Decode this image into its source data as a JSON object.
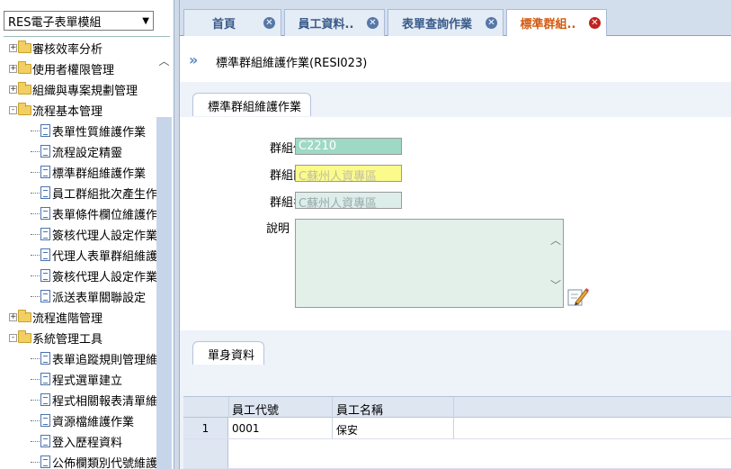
{
  "sidebar": {
    "module_select": "RES電子表單模組",
    "tree": [
      {
        "label": "審核效率分析",
        "type": "folder",
        "expander": "+"
      },
      {
        "label": "使用者權限管理",
        "type": "folder",
        "expander": "+"
      },
      {
        "label": "組織與專案規劃管理",
        "type": "folder",
        "expander": "+"
      },
      {
        "label": "流程基本管理",
        "type": "folder",
        "expander": "-"
      },
      {
        "label": "表單性質維護作業",
        "type": "doc"
      },
      {
        "label": "流程設定精靈",
        "type": "doc"
      },
      {
        "label": "標準群組維護作業",
        "type": "doc"
      },
      {
        "label": "員工群組批次產生作",
        "type": "doc"
      },
      {
        "label": "表單條件欄位維護作",
        "type": "doc"
      },
      {
        "label": "簽核代理人設定作業",
        "type": "doc"
      },
      {
        "label": "代理人表單群組維護",
        "type": "doc"
      },
      {
        "label": "簽核代理人設定作業",
        "type": "doc"
      },
      {
        "label": "派送表單關聯設定",
        "type": "doc"
      },
      {
        "label": "流程進階管理",
        "type": "folder",
        "expander": "+"
      },
      {
        "label": "系統管理工具",
        "type": "folder",
        "expander": "-"
      },
      {
        "label": "表單追蹤規則管理維",
        "type": "doc"
      },
      {
        "label": "程式選單建立",
        "type": "doc"
      },
      {
        "label": "程式相關報表清單維",
        "type": "doc"
      },
      {
        "label": "資源檔維護作業",
        "type": "doc"
      },
      {
        "label": "登入歷程資料",
        "type": "doc"
      },
      {
        "label": "公佈欄類別代號維護",
        "type": "doc"
      }
    ]
  },
  "tabs": [
    {
      "label": "首頁",
      "active": false
    },
    {
      "label": "員工資料..",
      "active": false
    },
    {
      "label": "表單查詢作業",
      "active": false
    },
    {
      "label": "標準群組..",
      "active": true
    }
  ],
  "page": {
    "title": "標準群組維護作業(RESI023)",
    "section1_label": "標準群組維護作業",
    "section2_label": "單身資料"
  },
  "form": {
    "code_label": "群組代號",
    "code_value": "C2210",
    "short_label": "群組簡稱",
    "short_value": "C蘇州人資專區",
    "name_label": "群組名稱",
    "name_value": "C蘇州人資專區",
    "desc_label": "說明",
    "desc_value": ""
  },
  "grid": {
    "columns": [
      "員工代號",
      "員工名稱"
    ],
    "rows": [
      {
        "num": "1",
        "emp_id": "0001",
        "emp_name": "保安"
      }
    ]
  },
  "colors": {
    "active_tab_text": "#d25b12",
    "tab_text": "#3a5a8a",
    "close_active": "#c0221d",
    "close": "#5578a8",
    "code_field_bg": "#9ed9c6",
    "short_field_bg": "#fbfb8c"
  }
}
